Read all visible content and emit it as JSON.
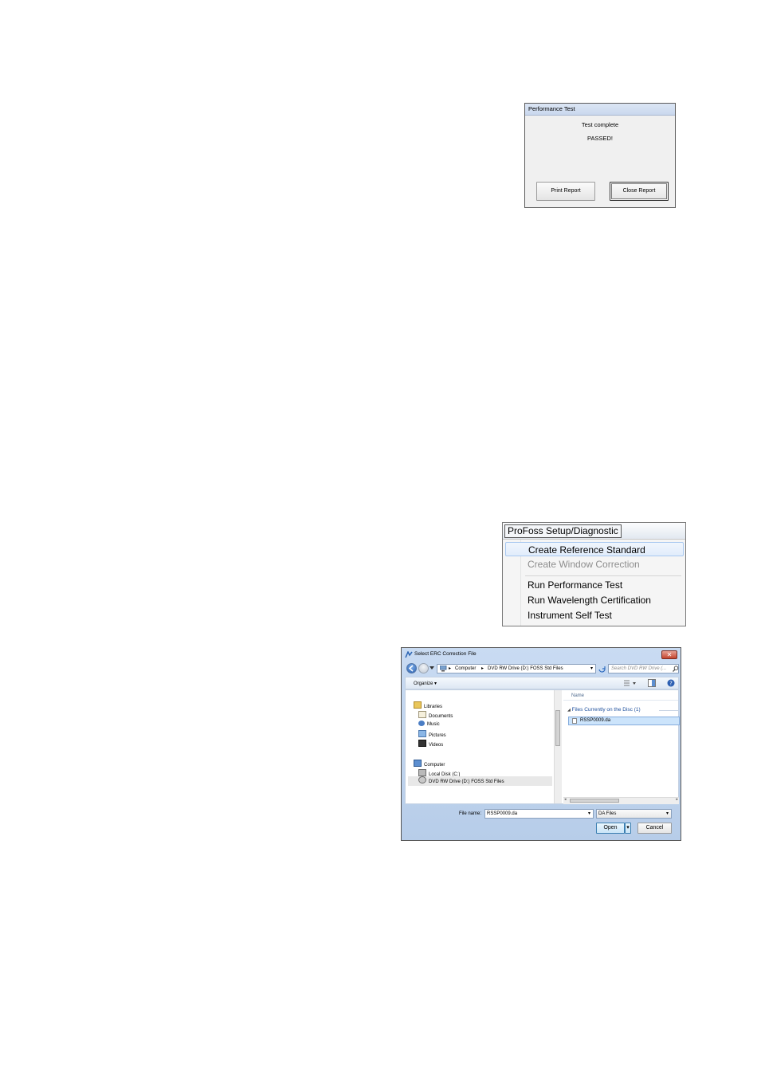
{
  "performance_dialog": {
    "title": "Performance Test",
    "message_line1": "Test complete",
    "message_line2": "PASSED!",
    "print_button": "Print Report",
    "close_button": "Close Report"
  },
  "menu": {
    "bar_title": "ProFoss Setup/Diagnostic",
    "items": [
      {
        "label": "Create Reference Standard",
        "state": "highlighted"
      },
      {
        "label": "Create Window Correction",
        "state": "disabled"
      },
      {
        "label": "Run Performance Test",
        "state": "normal"
      },
      {
        "label": "Run Wavelength Certification",
        "state": "normal"
      },
      {
        "label": "Instrument Self Test",
        "state": "normal"
      }
    ]
  },
  "file_dialog": {
    "title": "Select ERC Correction File",
    "close_symbol": "✕",
    "address": {
      "segment1": "Computer",
      "segment2": "DVD RW Drive (D:) FOSS Std Files"
    },
    "search_placeholder": "Search DVD RW Drive (...",
    "organize_label": "Organize ▾",
    "column_name": "Name",
    "group_label": "Files Currently on the Disc (1)",
    "file_item": "RSSP0009.da",
    "nav_tree": [
      "Libraries",
      "Documents",
      "Music",
      "Pictures",
      "Videos",
      "Computer",
      "Local Disk (C:)",
      "DVD RW Drive (D:) FOSS Std Files"
    ],
    "filename_label": "File name:",
    "filename_value": "RSSP0009.da",
    "filetype_value": "DA Files",
    "open_button": "Open",
    "cancel_button": "Cancel",
    "colors": {
      "title_gradient_top": "#c9dbf2",
      "selection": "#cce4fb",
      "close_red": "#c4442e"
    }
  }
}
